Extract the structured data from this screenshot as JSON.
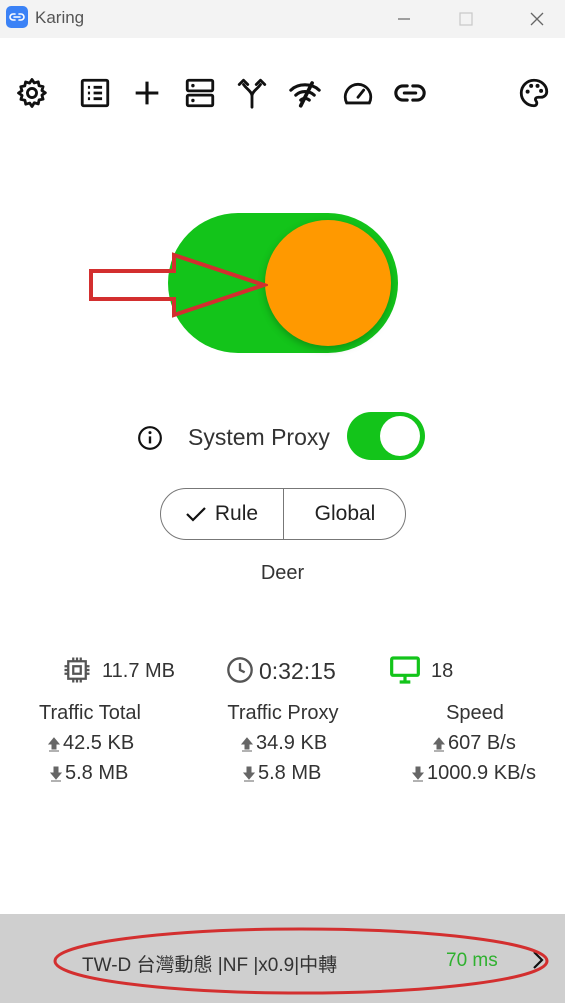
{
  "window": {
    "title": "Karing"
  },
  "toolbar": {
    "icons": [
      "gear-icon",
      "list-icon",
      "plus-icon",
      "server-icon",
      "split-icon",
      "wifi-slash-icon",
      "speedometer-icon",
      "link-icon",
      "palette-icon"
    ]
  },
  "main_switch": {
    "state": "on",
    "track_color": "#13c41a",
    "knob_color": "#ff9900",
    "annotation_color": "#d32f2f"
  },
  "system_proxy": {
    "label": "System Proxy",
    "enabled": true
  },
  "mode": {
    "rule_label": "Rule",
    "global_label": "Global",
    "selected": "Rule"
  },
  "profile": {
    "name": "Deer"
  },
  "stats": {
    "memory": "11.7 MB",
    "duration": "0:32:15",
    "connections": "18",
    "traffic_total": {
      "label": "Traffic Total",
      "up": "42.5 KB",
      "down": "5.8 MB"
    },
    "traffic_proxy": {
      "label": "Traffic Proxy",
      "up": "34.9 KB",
      "down": "5.8 MB"
    },
    "speed": {
      "label": "Speed",
      "up": "607 B/s",
      "down": "1000.9 KB/s"
    }
  },
  "node": {
    "name": "TW-D 台灣動態 |NF |x0.9|中轉",
    "latency": "70 ms",
    "latency_color": "#2fb12f"
  }
}
